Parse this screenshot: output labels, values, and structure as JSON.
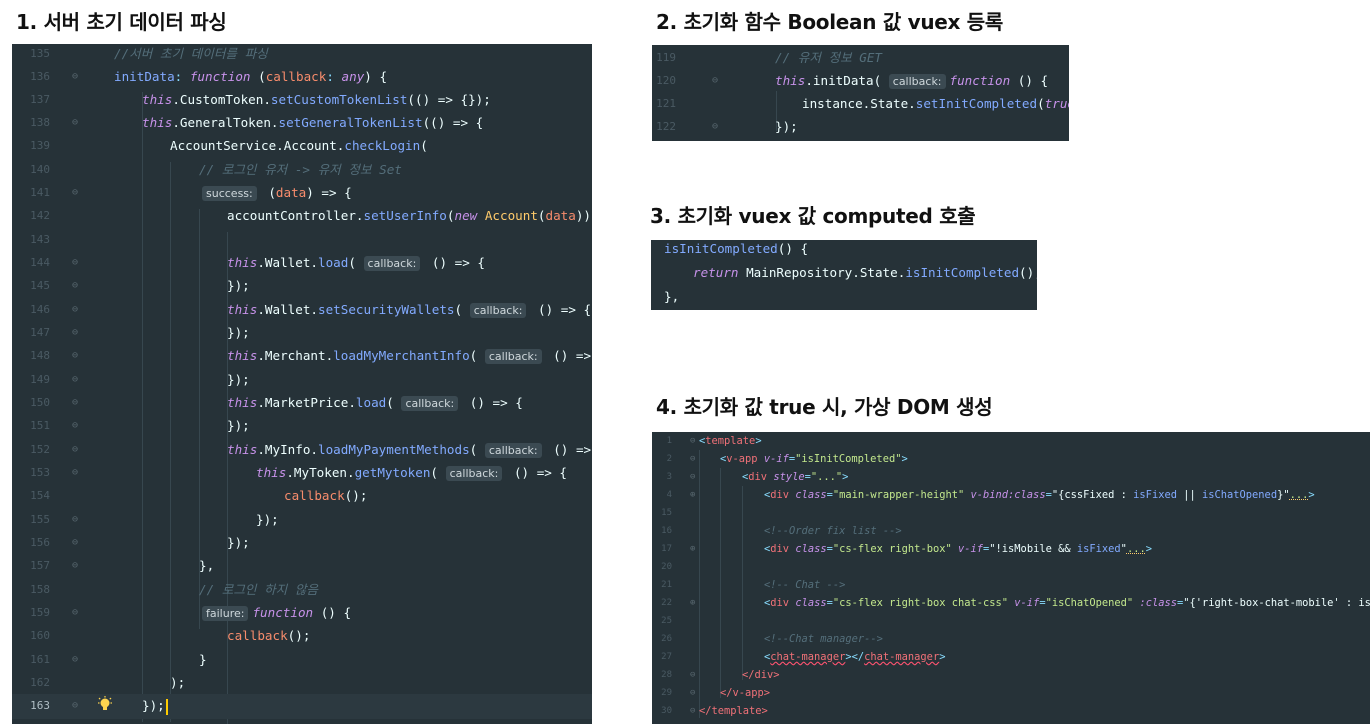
{
  "headings": {
    "h1": "1. 서버 초기 데이터 파싱",
    "h2": "2. 초기화 함수 Boolean 값 vuex 등록",
    "h3": "3. 초기화 vuex 값 computed 호출",
    "h4": "4. 초기화 값 true 시, 가상 DOM 생성"
  },
  "panel1": {
    "line_numbers": [
      "135",
      "136",
      "137",
      "138",
      "139",
      "140",
      "141",
      "142",
      "143",
      "144",
      "145",
      "146",
      "147",
      "148",
      "149",
      "150",
      "151",
      "152",
      "153",
      "154",
      "155",
      "156",
      "157",
      "158",
      "159",
      "160",
      "161",
      "162",
      "163"
    ],
    "t": {
      "l135": "//서버 초기 데이터를 파싱",
      "l136a": "initData",
      "l136b": ": ",
      "l136c": "function",
      "l136d": " (",
      "l136e": "callback",
      "l136f": ": ",
      "l136g": "any",
      "l136h": ") {",
      "this": "this",
      "l137a": ".CustomToken.",
      "l137b": "setCustomTokenList",
      "l137c": "(() => {});",
      "l138a": ".GeneralToken.",
      "l138b": "setGeneralTokenList",
      "l138c": "(() => {",
      "l139a": "AccountService.Account.",
      "l139b": "checkLogin",
      "l139c": "(",
      "l140a": "// 로그인 유저 -> 유저 정보 ",
      "l140b": "Set",
      "hint_success": "success:",
      "l141a": " (",
      "l141b": "data",
      "l141c": ") => {",
      "l142a": "accountController.",
      "l142b": "setUserInfo",
      "l142c": "(",
      "new": "new",
      "Account": "Account",
      "l142d": "(",
      "l142e": "data",
      "l142f": "));",
      "hint_callback": "callback:",
      "wallet": ".Wallet.",
      "load": "load",
      "paren": "(",
      "arrow": " () => {",
      "close": "});",
      "setSec": "setSecurityWallets",
      "merchant": ".Merchant.",
      "loadMer": "loadMyMerchantInfo",
      "market": ".MarketPrice.",
      "myinfo": ".MyInfo.",
      "loadPay": "loadMyPaymentMethods",
      "mytoken": ".MyToken.",
      "getMy": "getMytoken",
      "callback": "callback",
      "callend": "();",
      "l157": "},",
      "l158": "// 로그인 하지 않음",
      "hint_failure": "failure:",
      "function": "function",
      "l159b": " () {",
      "l161": "}",
      "l162": ");",
      "l163": "});"
    }
  },
  "panel2": {
    "line_numbers": [
      "119",
      "120",
      "121",
      "122"
    ],
    "t": {
      "c1": "// 유저 정보 ",
      "c2": "GET",
      "this": "this",
      "init": ".initData(",
      "hint": "callback:",
      "function": "function",
      "fnrest": " () {",
      "inst": "instance.State.",
      "setInit": "setInitCompleted",
      "p1": "(",
      "true": "true",
      "p2": ");",
      "close": "});"
    }
  },
  "panel3": {
    "t": {
      "l1a": "isInitCompleted",
      "l1b": "() {",
      "return": "return",
      "l2b": " MainRepository.State.",
      "l2c": "isInitCompleted",
      "l2d": "();",
      "l3": "},"
    }
  },
  "panel4": {
    "line_numbers": [
      "1",
      "2",
      "3",
      "4",
      "15",
      "16",
      "17",
      "20",
      "21",
      "22",
      "25",
      "26",
      "27",
      "28",
      "29",
      "30"
    ],
    "t": {
      "lt": "<",
      "gt": ">",
      "template": "template",
      "vapp": "v-app",
      "vif": "v-if",
      "eq": "=",
      "vif_val": "\"isInitCompleted\"",
      "div": "div",
      "style": "style",
      "style_val": "\"...\"",
      "class": "class",
      "cls4": "\"main-wrapper-height\"",
      "vbind": "v-bind:class",
      "bind4a": "\"{cssFixed : ",
      "bind4b": "isFixed",
      "bind4c": " || ",
      "bind4d": "isChatOpened",
      "bind4e": "}\"",
      "dots": "...",
      "c16": "<!--Order fix list -->",
      "cls17": "\"cs-flex right-box\"",
      "vif17a": "\"!isMobile && ",
      "vif17b": "isFixed",
      "vif17c": "\"",
      "c21": "<!-- Chat -->",
      "cls22": "\"cs-flex right-box chat-css\"",
      "vif22": "\"isChatOpened\"",
      "vclass": ":class",
      "vclass22": "\"{'right-box-chat-mobile' : isMobile}\"",
      "c26": "<!--Chat manager-->",
      "chat": "chat-manager",
      "closediv": "</div>",
      "closeapp": "</v-app>",
      "closetpl": "</template>"
    }
  },
  "colors": {
    "bg": "#263238",
    "keyword": "#c792ea",
    "function": "#82aaff",
    "param": "#f78c6c",
    "comment": "#546e7a",
    "caret": "#ffcc00"
  },
  "icons": {
    "bulb": "lightbulb-icon",
    "fold": "fold-marker-icon"
  }
}
